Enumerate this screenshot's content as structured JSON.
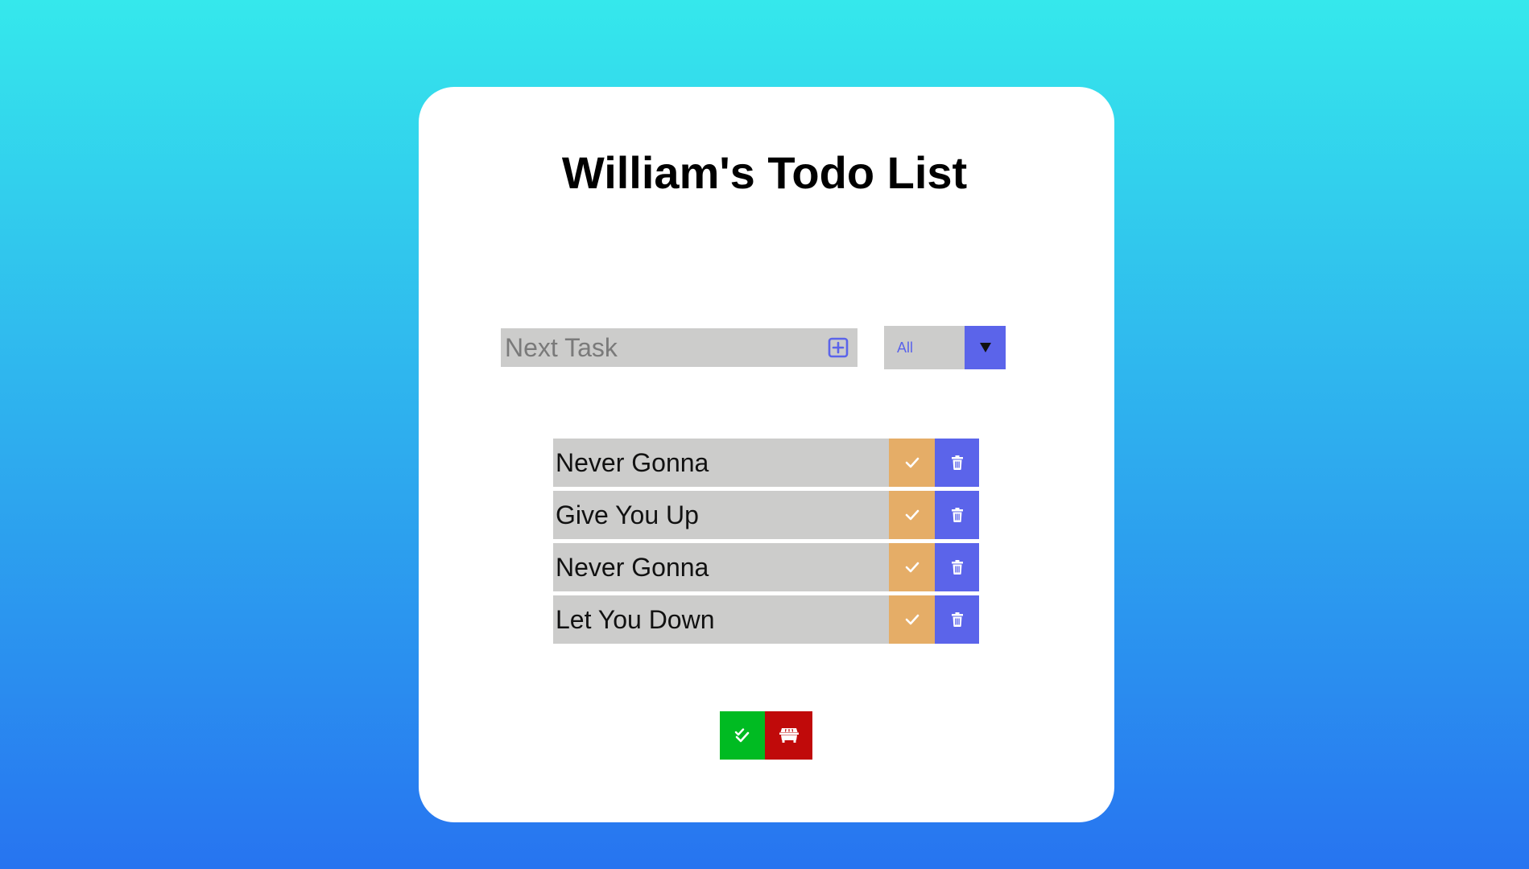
{
  "app": {
    "title": "William's Todo List"
  },
  "input": {
    "placeholder": "Next Task",
    "value": "",
    "add_icon": "plus-square-icon"
  },
  "filter": {
    "selected": "All",
    "icon": "triangle-down-icon"
  },
  "todos": [
    {
      "text": "Never Gonna"
    },
    {
      "text": "Give You Up"
    },
    {
      "text": "Never Gonna"
    },
    {
      "text": "Let You Down"
    }
  ],
  "actions": {
    "complete_icon": "check-icon",
    "delete_icon": "trash-icon",
    "complete_all_icon": "double-check-icon",
    "clear_icon": "dumpster-icon"
  },
  "colors": {
    "background_top": "#35e8ec",
    "background_bottom": "#2774f0",
    "card": "#ffffff",
    "input_bg": "#cccccb",
    "accent": "#5b64ea",
    "complete": "#e5ad67",
    "complete_all": "#00bb22",
    "clear": "#c00a0a"
  }
}
